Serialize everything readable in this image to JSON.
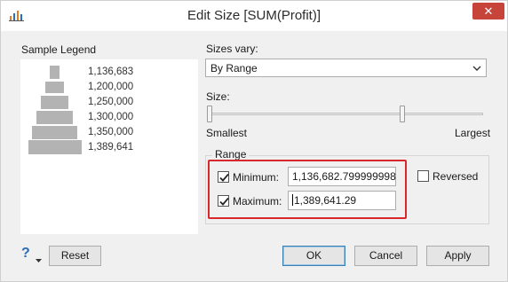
{
  "window": {
    "title": "Edit Size [SUM(Profit)]",
    "close_glyph": "✕"
  },
  "legend": {
    "label": "Sample Legend",
    "items": [
      "1,136,683",
      "1,200,000",
      "1,250,000",
      "1,300,000",
      "1,350,000",
      "1,389,641"
    ]
  },
  "sizes_vary": {
    "label": "Sizes vary:",
    "selected": "By Range"
  },
  "size_slider": {
    "label": "Size:",
    "min_label": "Smallest",
    "max_label": "Largest"
  },
  "range": {
    "title": "Range",
    "minimum": {
      "label": "Minimum:",
      "value": "1,136,682.799999998",
      "checked": true
    },
    "maximum": {
      "label": "Maximum:",
      "value": "1,389,641.29",
      "checked": true
    },
    "reversed": {
      "label": "Reversed",
      "checked": false
    }
  },
  "footer": {
    "help_icon": "question-icon",
    "reset_label": "Reset",
    "ok_label": "OK",
    "cancel_label": "Cancel",
    "apply_label": "Apply"
  },
  "colors": {
    "accent": "#2e6db5",
    "highlight": "#d9272e",
    "legend_mark": "#b3b3b3"
  }
}
